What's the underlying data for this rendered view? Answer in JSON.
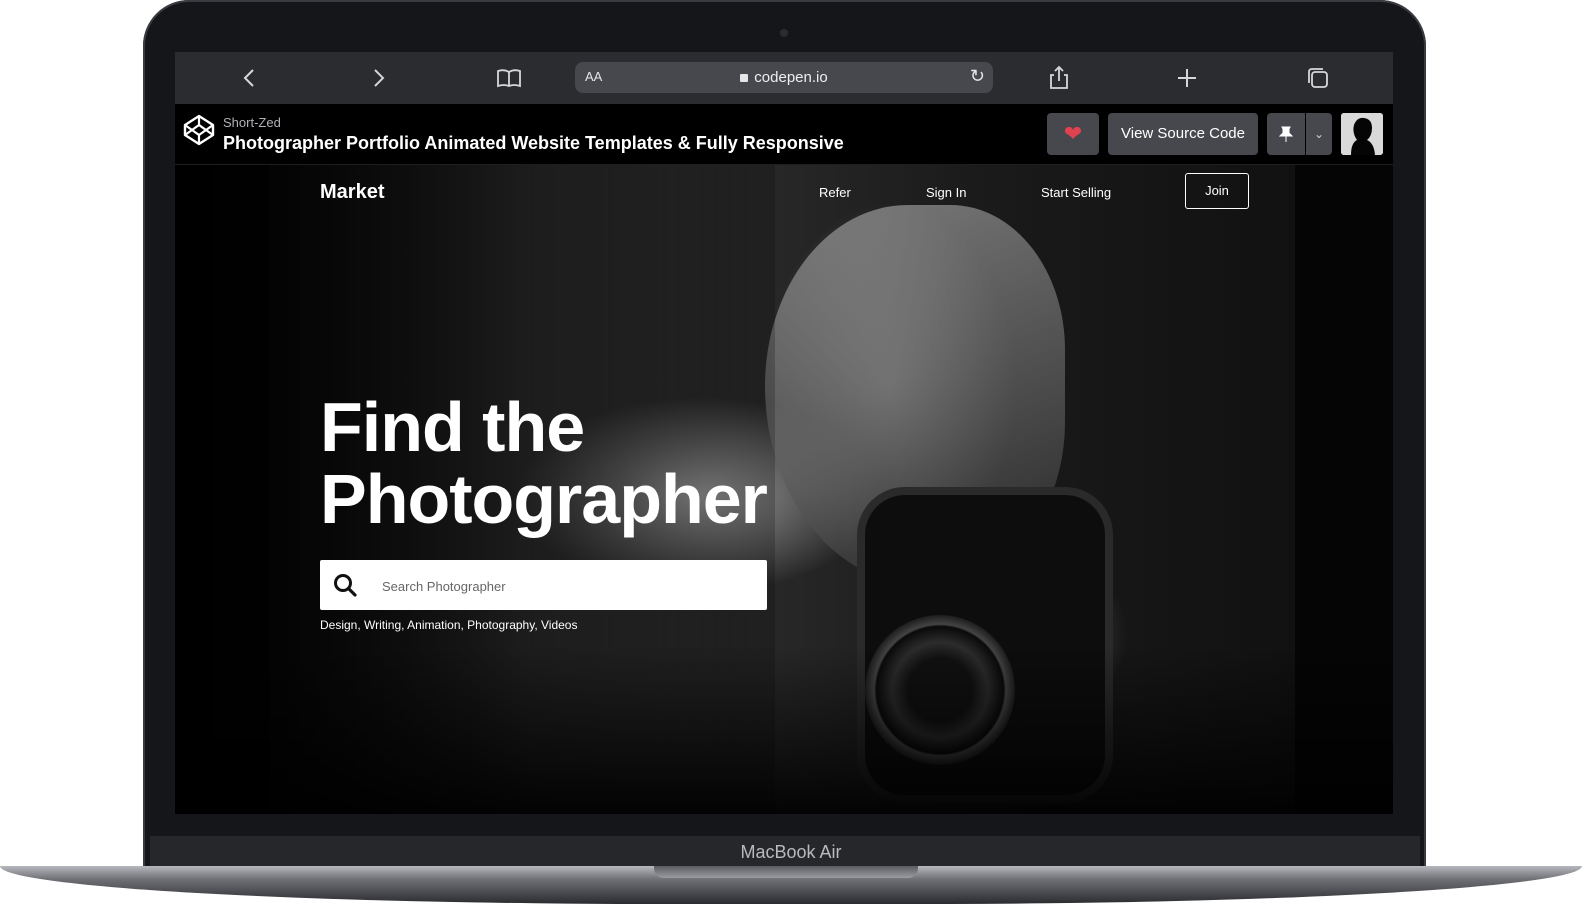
{
  "device": {
    "model_label": "MacBook Air"
  },
  "browser": {
    "url": "codepen.io",
    "reader_label": "AA",
    "icons": [
      "chevron-left-icon",
      "chevron-right-icon",
      "book-icon",
      "lock-icon",
      "reload-icon",
      "share-icon",
      "plus-icon",
      "tabs-icon"
    ]
  },
  "codepen": {
    "author": "Short-Zed",
    "title": "Photographer Portfolio Animated Website Templates & Fully Responsive",
    "heart_icon": "heart-icon",
    "view_source_label": "View Source Code",
    "pin_icon": "pin-icon",
    "dropdown_icon": "chevron-down-icon",
    "accent_heart": "#e0424f"
  },
  "site": {
    "brand": "Market",
    "nav": {
      "refer": "Refer",
      "sign_in": "Sign In",
      "start_selling": "Start Selling",
      "join": "Join"
    },
    "headline_line1": "Find the",
    "headline_line2": "Photographer",
    "search": {
      "placeholder": "Search Photographer"
    },
    "categories": "Design, Writing, Animation, Photography, Videos"
  }
}
